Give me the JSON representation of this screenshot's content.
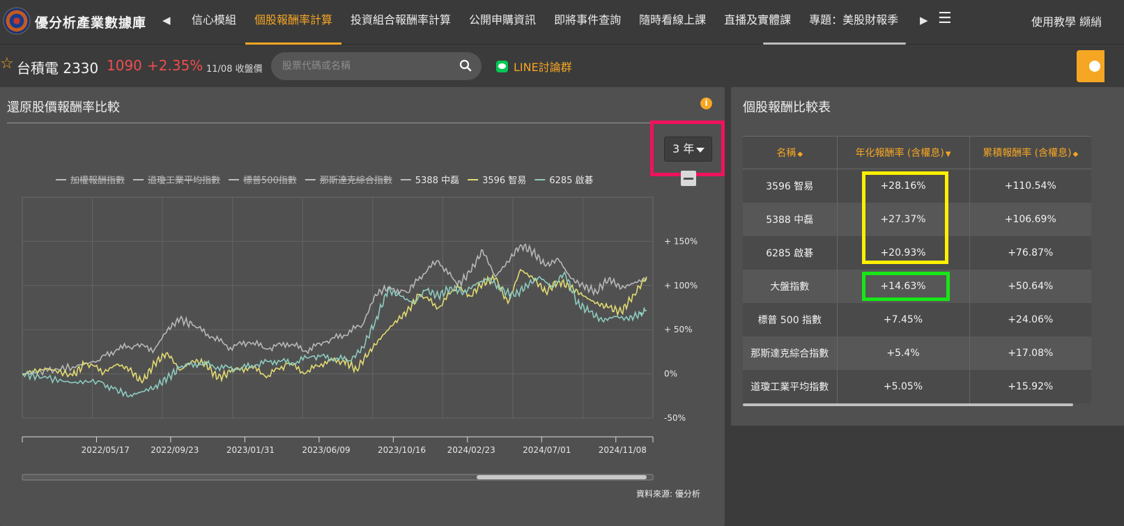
{
  "header": {
    "brand": "優分析產業數據庫",
    "nav_prev_icon": "◀",
    "nav_next_icon": "▶",
    "nav_items": [
      "信心模組",
      "個股報酬率計算",
      "投資組合報酬率計算",
      "公開申購資訊",
      "即將事件查詢",
      "隨時看線上課",
      "直播及實體課",
      "專題：美股財報季"
    ],
    "active_nav": "個股報酬率計算",
    "menu_icon": "☰",
    "right_link": "使用教學 纐綃"
  },
  "stock": {
    "star_icon": "☆",
    "name": "台積電 2330",
    "price": "1090",
    "change": "+2.35%",
    "date_label": "11/08 收盤價",
    "search_placeholder": "股票代碼或名稱",
    "line_label": "LINE討論群"
  },
  "left_panel": {
    "title": "還原股價報酬率比較",
    "period": "3 年",
    "source": "資料來源: 優分析"
  },
  "chart_data": {
    "type": "line",
    "title": "",
    "xlabel": "",
    "ylabel": "",
    "legend": [
      {
        "name": "加權報酬指數",
        "color": "#bdbdbd",
        "hidden": true
      },
      {
        "name": "道瓊工業平均指數",
        "color": "#bdbdbd",
        "hidden": true
      },
      {
        "name": "標普500指數",
        "color": "#bdbdbd",
        "hidden": true
      },
      {
        "name": "那斯達克綜合指數",
        "color": "#bdbdbd",
        "hidden": true
      },
      {
        "name": "5388 中磊",
        "color": "#b8b8b8",
        "hidden": false
      },
      {
        "name": "3596 智易",
        "color": "#e3dc72",
        "hidden": false
      },
      {
        "name": "6285 啟碁",
        "color": "#8ecbc0",
        "hidden": false
      }
    ],
    "y_ticks": [
      "+ 150%",
      "+ 100%",
      "+ 50%",
      "0%",
      "-50%"
    ],
    "y_tick_values": [
      150,
      100,
      50,
      0,
      -50
    ],
    "ylim": [
      -50,
      200
    ],
    "x_ticks": [
      "2022/05/17",
      "2022/09/23",
      "2023/01/31",
      "2023/06/09",
      "2023/10/16",
      "2024/02/23",
      "2024/07/01",
      "2024/11/08"
    ],
    "x_tick_values": [
      0.17,
      0.28,
      0.4,
      0.52,
      0.64,
      0.75,
      0.87,
      0.99
    ],
    "series": [
      {
        "name": "5388 中磊",
        "color": "#b8b8b8",
        "points": [
          [
            0,
            0
          ],
          [
            0.04,
            3
          ],
          [
            0.08,
            8
          ],
          [
            0.12,
            15
          ],
          [
            0.15,
            28
          ],
          [
            0.18,
            32
          ],
          [
            0.21,
            28
          ],
          [
            0.23,
            50
          ],
          [
            0.25,
            62
          ],
          [
            0.27,
            55
          ],
          [
            0.3,
            42
          ],
          [
            0.33,
            30
          ],
          [
            0.36,
            36
          ],
          [
            0.39,
            28
          ],
          [
            0.42,
            35
          ],
          [
            0.45,
            26
          ],
          [
            0.48,
            36
          ],
          [
            0.51,
            44
          ],
          [
            0.54,
            56
          ],
          [
            0.56,
            90
          ],
          [
            0.58,
            98
          ],
          [
            0.61,
            92
          ],
          [
            0.63,
            110
          ],
          [
            0.66,
            128
          ],
          [
            0.69,
            100
          ],
          [
            0.71,
            115
          ],
          [
            0.73,
            140
          ],
          [
            0.75,
            110
          ],
          [
            0.77,
            127
          ],
          [
            0.79,
            146
          ],
          [
            0.81,
            138
          ],
          [
            0.83,
            122
          ],
          [
            0.85,
            130
          ],
          [
            0.87,
            108
          ],
          [
            0.89,
            99
          ],
          [
            0.91,
            93
          ],
          [
            0.93,
            108
          ],
          [
            0.95,
            97
          ],
          [
            0.97,
            103
          ],
          [
            0.99,
            108
          ]
        ]
      },
      {
        "name": "3596 智易",
        "color": "#e3dc72",
        "points": [
          [
            0,
            0
          ],
          [
            0.04,
            6
          ],
          [
            0.08,
            -2
          ],
          [
            0.1,
            12
          ],
          [
            0.13,
            2
          ],
          [
            0.15,
            11
          ],
          [
            0.17,
            5
          ],
          [
            0.19,
            -10
          ],
          [
            0.21,
            12
          ],
          [
            0.23,
            24
          ],
          [
            0.25,
            4
          ],
          [
            0.27,
            15
          ],
          [
            0.29,
            12
          ],
          [
            0.31,
            -5
          ],
          [
            0.33,
            2
          ],
          [
            0.36,
            8
          ],
          [
            0.39,
            -2
          ],
          [
            0.42,
            12
          ],
          [
            0.45,
            1
          ],
          [
            0.48,
            14
          ],
          [
            0.51,
            15
          ],
          [
            0.53,
            5
          ],
          [
            0.55,
            25
          ],
          [
            0.57,
            42
          ],
          [
            0.59,
            58
          ],
          [
            0.61,
            70
          ],
          [
            0.63,
            90
          ],
          [
            0.66,
            75
          ],
          [
            0.69,
            100
          ],
          [
            0.71,
            88
          ],
          [
            0.73,
            103
          ],
          [
            0.75,
            108
          ],
          [
            0.77,
            80
          ],
          [
            0.79,
            118
          ],
          [
            0.81,
            108
          ],
          [
            0.83,
            93
          ],
          [
            0.85,
            105
          ],
          [
            0.87,
            98
          ],
          [
            0.89,
            88
          ],
          [
            0.91,
            80
          ],
          [
            0.93,
            75
          ],
          [
            0.95,
            70
          ],
          [
            0.97,
            90
          ],
          [
            0.99,
            110
          ]
        ]
      },
      {
        "name": "6285 啟碁",
        "color": "#8ecbc0",
        "points": [
          [
            0,
            0
          ],
          [
            0.04,
            -5
          ],
          [
            0.08,
            -10
          ],
          [
            0.12,
            -8
          ],
          [
            0.15,
            -18
          ],
          [
            0.17,
            -25
          ],
          [
            0.19,
            -20
          ],
          [
            0.21,
            -15
          ],
          [
            0.23,
            -5
          ],
          [
            0.25,
            7
          ],
          [
            0.28,
            12
          ],
          [
            0.31,
            8
          ],
          [
            0.34,
            5
          ],
          [
            0.37,
            10
          ],
          [
            0.4,
            15
          ],
          [
            0.43,
            12
          ],
          [
            0.46,
            20
          ],
          [
            0.49,
            18
          ],
          [
            0.52,
            15
          ],
          [
            0.54,
            30
          ],
          [
            0.56,
            60
          ],
          [
            0.58,
            95
          ],
          [
            0.6,
            88
          ],
          [
            0.62,
            80
          ],
          [
            0.64,
            95
          ],
          [
            0.66,
            88
          ],
          [
            0.68,
            98
          ],
          [
            0.7,
            92
          ],
          [
            0.72,
            102
          ],
          [
            0.74,
            108
          ],
          [
            0.76,
            95
          ],
          [
            0.78,
            88
          ],
          [
            0.8,
            100
          ],
          [
            0.82,
            110
          ],
          [
            0.84,
            98
          ],
          [
            0.86,
            115
          ],
          [
            0.88,
            80
          ],
          [
            0.9,
            70
          ],
          [
            0.92,
            60
          ],
          [
            0.94,
            65
          ],
          [
            0.96,
            62
          ],
          [
            0.98,
            68
          ],
          [
            0.99,
            72
          ]
        ]
      }
    ]
  },
  "right_panel": {
    "title": "個股報酬比較表",
    "columns": [
      "名稱",
      "年化報酬率 (含權息)",
      "累積報酬率 (含權息)"
    ],
    "rows": [
      {
        "name": "3596 智易",
        "annual": "+28.16%",
        "cumulative": "+110.54%"
      },
      {
        "name": "5388 中磊",
        "annual": "+27.37%",
        "cumulative": "+106.69%"
      },
      {
        "name": "6285 啟碁",
        "annual": "+20.93%",
        "cumulative": "+76.87%"
      },
      {
        "name": "大盤指數",
        "annual": "+14.63%",
        "cumulative": "+50.64%"
      },
      {
        "name": "標普 500 指數",
        "annual": "+7.45%",
        "cumulative": "+24.06%"
      },
      {
        "name": "那斯達克綜合指數",
        "annual": "+5.4%",
        "cumulative": "+17.08%"
      },
      {
        "name": "道瓊工業平均指數",
        "annual": "+5.05%",
        "cumulative": "+15.92%"
      }
    ]
  }
}
